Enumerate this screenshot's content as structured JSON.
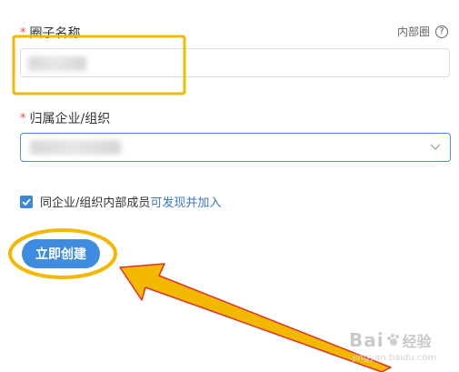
{
  "form": {
    "circle_name": {
      "required_mark": "*",
      "label": "圈子名称",
      "value": "",
      "scope_hint": "内部圈",
      "help_glyph": "?"
    },
    "organization": {
      "required_mark": "*",
      "label": "归属企业/组织",
      "selected_value": ""
    },
    "discoverable": {
      "checked": true,
      "label_prefix": "同企业/组织内部成员",
      "label_highlight": "可发现并加入"
    },
    "create_button_label": "立即创建"
  },
  "annotations": {
    "highlight_color": "#f5b800",
    "arrow_color": "#f5b800",
    "arrow_edge_color": "#d8322a"
  },
  "watermark": {
    "text": "Bai",
    "suffix": "经验",
    "sub": "jingyan.baidu.com"
  },
  "colors": {
    "accent": "#3f8be0",
    "required": "#e74c3c",
    "link_highlight": "#3a78c2"
  }
}
